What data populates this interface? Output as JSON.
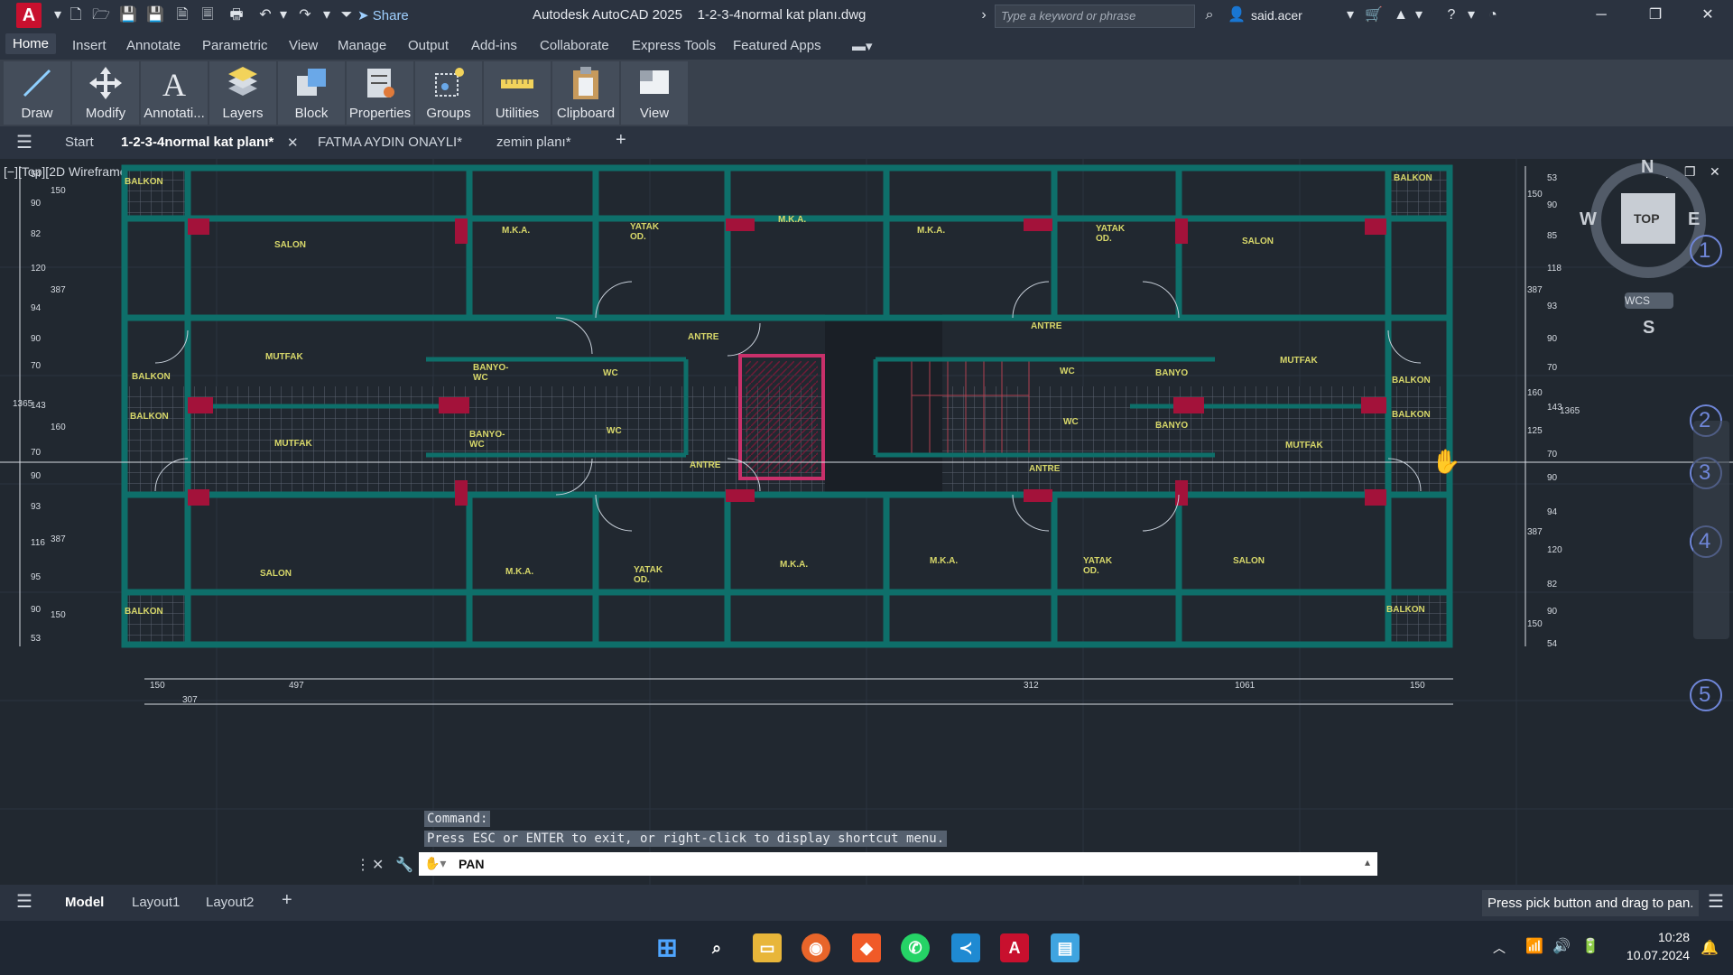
{
  "titlebar": {
    "logo_letter": "A",
    "share_label": "Share",
    "title": "Autodesk AutoCAD 2025    1-2-3-4normal kat planı.dwg",
    "search_placeholder": "Type a keyword or phrase",
    "user": "said.acer"
  },
  "menu": [
    "Home",
    "Insert",
    "Annotate",
    "Parametric",
    "View",
    "Manage",
    "Output",
    "Add-ins",
    "Collaborate",
    "Express Tools",
    "Featured Apps"
  ],
  "ribbon": [
    "Draw",
    "Modify",
    "Annotati...",
    "Layers",
    "Block",
    "Properties",
    "Groups",
    "Utilities",
    "Clipboard",
    "View"
  ],
  "tabs": {
    "start": "Start",
    "docs": [
      "1-2-3-4normal kat planı*",
      "FATMA AYDIN ONAYLI*",
      "zemin planı*"
    ]
  },
  "viewport": {
    "label": "[−][Top][2D Wireframe]",
    "compass": {
      "n": "N",
      "s": "S",
      "e": "E",
      "w": "W",
      "top": "TOP",
      "wcs": "WCS"
    }
  },
  "grid_bubbles": [
    "1",
    "2",
    "3",
    "4",
    "5"
  ],
  "rooms": {
    "top": [
      "BALKON",
      "SALON",
      "M.K.A.",
      "YATAK OD.",
      "M.K.A.",
      "M.K.A.",
      "YATAK OD.",
      "SALON",
      "BALKON"
    ],
    "middle": [
      "BALKON",
      "MUTFAK",
      "BANYO-WC",
      "WC",
      "ANTRE",
      "ANTRE",
      "WC",
      "BANYO",
      "MUTFAK",
      "BALKON",
      "BALKON",
      "BANYO-WC",
      "WC",
      "WC",
      "BANYO",
      "MUTFAK",
      "BALKON",
      "MUTFAK",
      "ANTRE",
      "ANTRE"
    ],
    "bottom": [
      "BALKON",
      "SALON",
      "M.K.A.",
      "YATAK OD.",
      "M.K.A.",
      "M.K.A.",
      "YATAK OD.",
      "SALON",
      "BALKON"
    ]
  },
  "dims": {
    "left": [
      "54",
      "150",
      "90",
      "82",
      "387",
      "120",
      "94",
      "90",
      "70",
      "143",
      "160",
      "70",
      "90",
      "93",
      "387",
      "116",
      "95",
      "150",
      "90",
      "53"
    ],
    "left_total": "1365",
    "right": [
      "53",
      "150",
      "90",
      "85",
      "118",
      "387",
      "93",
      "90",
      "70",
      "160",
      "143",
      "125",
      "70",
      "90",
      "94",
      "387",
      "120",
      "82",
      "90",
      "150",
      "54"
    ],
    "right_total": "1365",
    "bottom": [
      "150",
      "497",
      "307",
      "312",
      "1061",
      "150"
    ]
  },
  "command": {
    "history": [
      "Command:",
      "Press ESC or ENTER to exit, or right-click to display shortcut menu."
    ],
    "current": "PAN"
  },
  "layouts": [
    "Model",
    "Layout1",
    "Layout2"
  ],
  "status_message": "Press pick button and drag to pan.",
  "clock": {
    "time": "10:28",
    "date": "10.07.2024"
  },
  "colors": {
    "wall": "#0e6f6a",
    "label": "#d8d86a",
    "column": "#a3123a",
    "grid": "#2c3440"
  }
}
